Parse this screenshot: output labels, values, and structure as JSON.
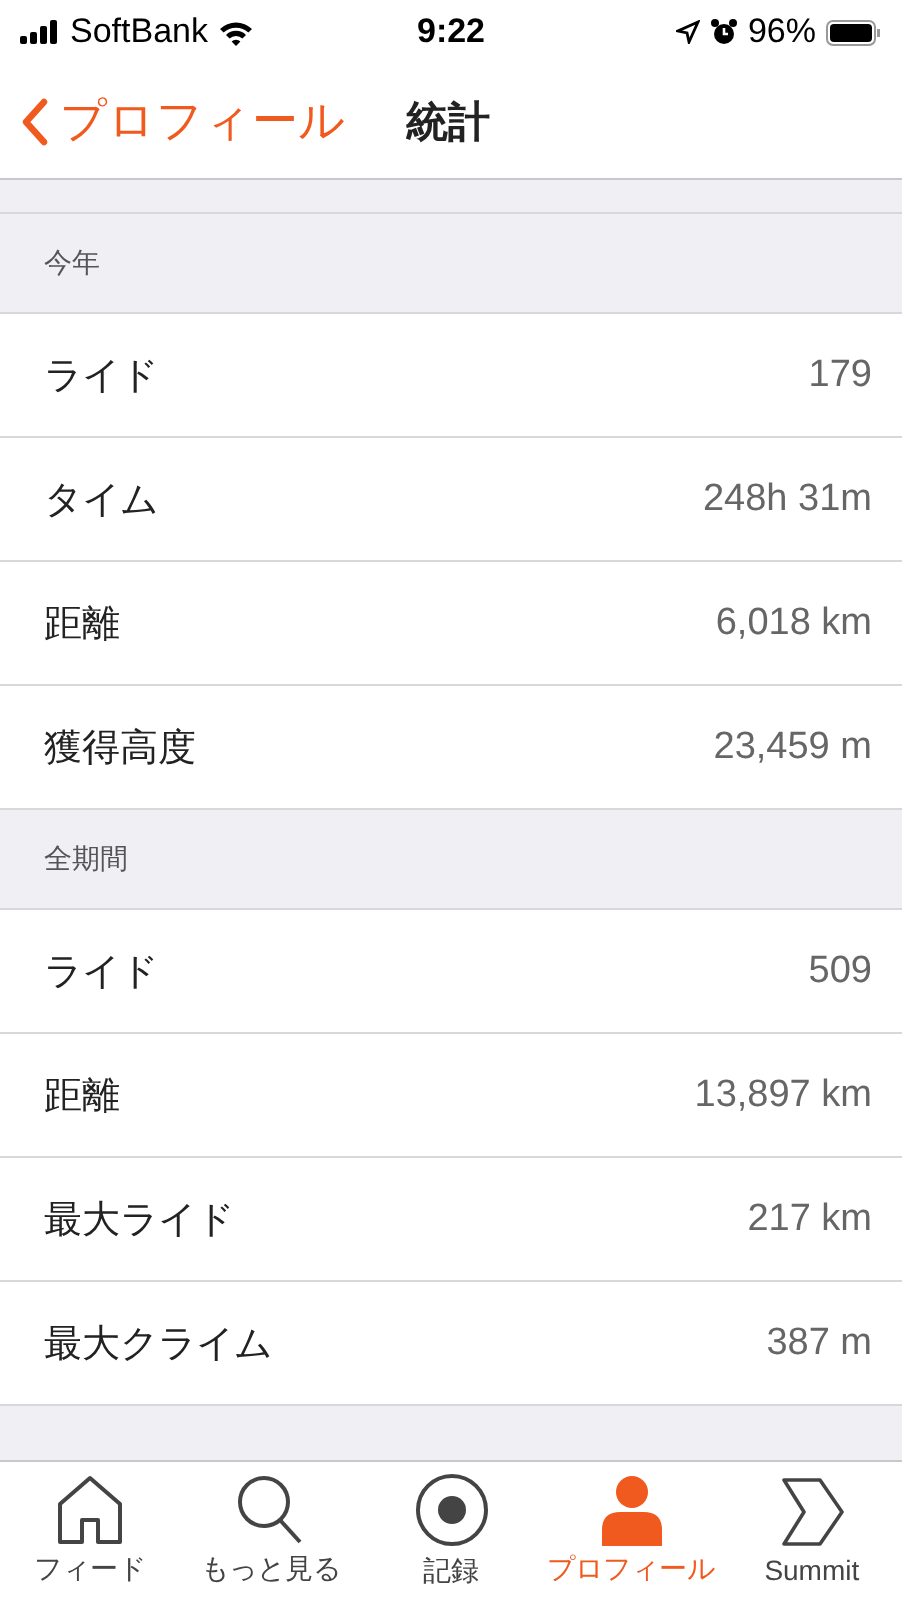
{
  "status_bar": {
    "carrier": "SoftBank",
    "time": "9:22",
    "battery": "96%"
  },
  "nav_bar": {
    "back": "プロフィール",
    "title": "統計"
  },
  "sections": [
    {
      "header": "今年",
      "rows": [
        {
          "label": "ライド",
          "value": "179"
        },
        {
          "label": "タイム",
          "value": "248h 31m"
        },
        {
          "label": "距離",
          "value": "6,018 km"
        },
        {
          "label": "獲得高度",
          "value": "23,459 m"
        }
      ]
    },
    {
      "header": "全期間",
      "rows": [
        {
          "label": "ライド",
          "value": "509"
        },
        {
          "label": "距離",
          "value": "13,897 km"
        },
        {
          "label": "最大ライド",
          "value": "217 km"
        },
        {
          "label": "最大クライム",
          "value": "387 m"
        }
      ]
    }
  ],
  "tab_bar": [
    {
      "kind": "home",
      "label": "フィード",
      "selected": false
    },
    {
      "kind": "search",
      "label": "もっと見る",
      "selected": false
    },
    {
      "kind": "record",
      "label": "記録",
      "selected": false
    },
    {
      "kind": "profile",
      "label": "プロフィール",
      "selected": true
    },
    {
      "kind": "summit",
      "label": "Summit",
      "selected": false
    }
  ]
}
